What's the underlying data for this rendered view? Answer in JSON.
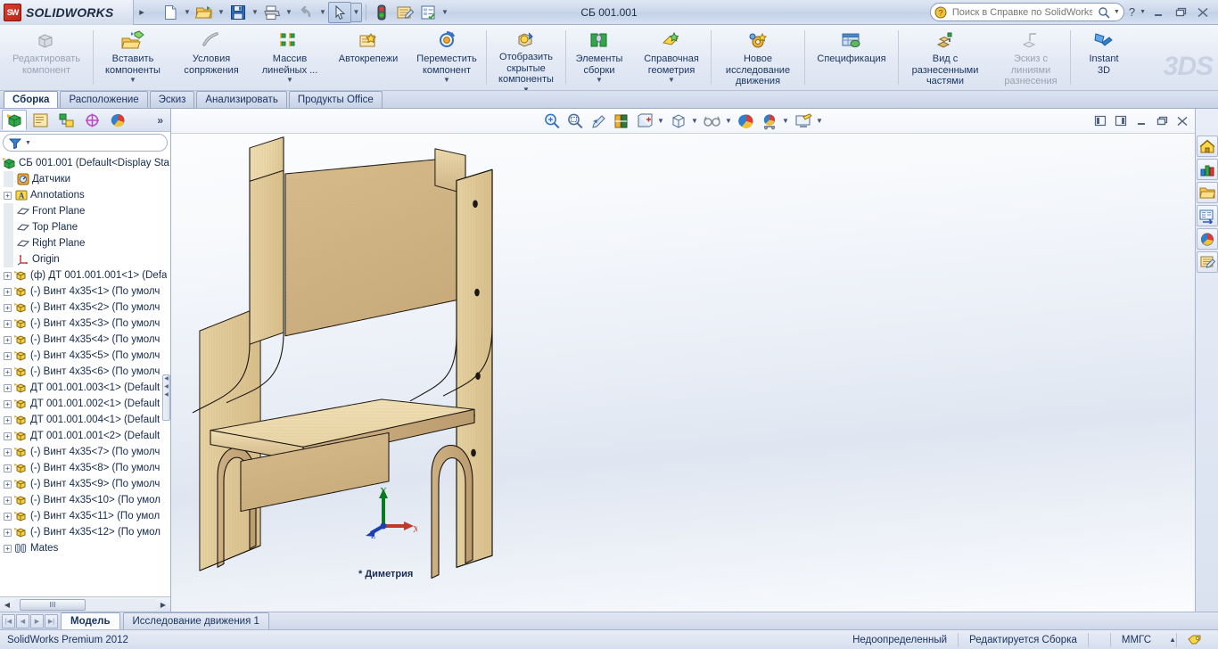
{
  "app": {
    "brand": "SOLIDWORKS",
    "brand_short": "SW",
    "document_title": "СБ 001.001",
    "watermark": "3DS",
    "status_product": "SolidWorks Premium 2012"
  },
  "titlebar": {
    "quick_access": [
      {
        "name": "new-document",
        "label": "Создать",
        "icon": "new-doc-icon",
        "dropdown": true
      },
      {
        "name": "open-document",
        "label": "Открыть",
        "icon": "open-folder-icon",
        "dropdown": true
      },
      {
        "name": "save-document",
        "label": "Сохранить",
        "icon": "save-disk-icon",
        "dropdown": true
      },
      {
        "name": "print-document",
        "label": "Печать",
        "icon": "printer-icon",
        "dropdown": true
      },
      {
        "name": "undo",
        "label": "Отменить",
        "icon": "undo-arrow-icon",
        "dropdown": true
      },
      {
        "name": "select",
        "label": "Выбрать",
        "icon": "cursor-arrow-icon",
        "dropdown": true
      },
      {
        "name": "rebuild",
        "label": "Перестроить",
        "icon": "traffic-light-icon",
        "dropdown": false
      },
      {
        "name": "options",
        "label": "Настройки",
        "icon": "options-icon",
        "dropdown": false
      },
      {
        "name": "properties",
        "label": "Свойства",
        "icon": "checklist-icon",
        "dropdown": true
      }
    ],
    "search": {
      "placeholder": "Поиск в Справке по SolidWorks",
      "value": "",
      "icon": "help-search-icon"
    },
    "help_label": "?",
    "window_buttons": [
      "minimize",
      "restore",
      "close"
    ]
  },
  "ribbon": {
    "items": [
      {
        "label": "Редактировать\nкомпонент",
        "l1": "Редактировать",
        "l2": "компонент",
        "icon": "edit-component-icon",
        "dimmed": true,
        "caret": false
      },
      {
        "label": "Вставить компоненты",
        "l1": "Вставить",
        "l2": "компоненты",
        "icon": "insert-components-icon",
        "dimmed": false,
        "caret": true
      },
      {
        "label": "Условия сопряжения",
        "l1": "Условия",
        "l2": "сопряжения",
        "icon": "mate-icon",
        "dimmed": false,
        "caret": false
      },
      {
        "label": "Массив линейных ...",
        "l1": "Массив",
        "l2": "линейных ...",
        "icon": "linear-pattern-icon",
        "dimmed": false,
        "caret": true
      },
      {
        "label": "Автокрепежи",
        "l1": "Автокрепежи",
        "l2": "",
        "icon": "smart-fasteners-icon",
        "dimmed": false,
        "caret": false
      },
      {
        "label": "Переместить компонент",
        "l1": "Переместить",
        "l2": "компонент",
        "icon": "move-component-icon",
        "dimmed": false,
        "caret": true
      },
      {
        "label": "Отобразить скрытые компоненты",
        "l1": "Отобразить",
        "l2": "скрытые",
        "l3": "компоненты",
        "icon": "show-hidden-icon",
        "dimmed": false,
        "caret": true
      },
      {
        "label": "Элементы сборки",
        "l1": "Элементы",
        "l2": "сборки",
        "icon": "assembly-features-icon",
        "dimmed": false,
        "caret": true
      },
      {
        "label": "Справочная геометрия",
        "l1": "Справочная",
        "l2": "геометрия",
        "icon": "reference-geometry-icon",
        "dimmed": false,
        "caret": true
      },
      {
        "label": "Новое исследование движения",
        "l1": "Новое",
        "l2": "исследование",
        "l3": "движения",
        "icon": "new-motion-study-icon",
        "dimmed": false,
        "caret": false
      },
      {
        "label": "Спецификация",
        "l1": "Спецификация",
        "l2": "",
        "icon": "bill-of-materials-icon",
        "dimmed": false,
        "caret": false
      },
      {
        "label": "Вид с разнесенными частями",
        "l1": "Вид с",
        "l2": "разнесенными",
        "l3": "частями",
        "icon": "exploded-view-icon",
        "dimmed": false,
        "caret": false
      },
      {
        "label": "Эскиз с линиями разнесения",
        "l1": "Эскиз с",
        "l2": "линиями",
        "l3": "разнесения",
        "icon": "explode-line-sketch-icon",
        "dimmed": true,
        "caret": false
      },
      {
        "label": "Instant 3D",
        "l1": "Instant",
        "l2": "3D",
        "icon": "instant3d-icon",
        "dimmed": false,
        "caret": false
      }
    ]
  },
  "command_tabs": {
    "tabs": [
      {
        "label": "Сборка",
        "active": true
      },
      {
        "label": "Расположение",
        "active": false
      },
      {
        "label": "Эскиз",
        "active": false
      },
      {
        "label": "Анализировать",
        "active": false
      },
      {
        "label": "Продукты Office",
        "active": false
      }
    ]
  },
  "feature_manager": {
    "tabs": [
      {
        "name": "feature-tree-tab",
        "icon": "feature-tree-icon",
        "active": true
      },
      {
        "name": "property-manager-tab",
        "icon": "property-manager-icon",
        "active": false
      },
      {
        "name": "configuration-manager-tab",
        "icon": "configuration-manager-icon",
        "active": false
      },
      {
        "name": "dimxpert-manager-tab",
        "icon": "dimxpert-icon",
        "active": false
      },
      {
        "name": "display-manager-tab",
        "icon": "display-manager-icon",
        "active": false
      }
    ],
    "more_label": "»",
    "filter": {
      "placeholder": "",
      "value": "",
      "icon": "filter-funnel-icon"
    },
    "tree": [
      {
        "label": "СБ 001.001  (Default<Display Sta",
        "icon": "assembly-icon",
        "expand": "none",
        "indent": 0,
        "root": true
      },
      {
        "label": "Датчики",
        "icon": "sensors-icon",
        "expand": "none",
        "indent": 1
      },
      {
        "label": "Annotations",
        "icon": "annotations-icon",
        "expand": "plus",
        "indent": 1
      },
      {
        "label": "Front Plane",
        "icon": "plane-icon",
        "expand": "none",
        "indent": 1
      },
      {
        "label": "Top Plane",
        "icon": "plane-icon",
        "expand": "none",
        "indent": 1
      },
      {
        "label": "Right Plane",
        "icon": "plane-icon",
        "expand": "none",
        "indent": 1
      },
      {
        "label": "Origin",
        "icon": "origin-icon",
        "expand": "none",
        "indent": 1
      },
      {
        "label": "(ф) ДТ 001.001.001<1>  (Defa",
        "icon": "part-icon",
        "expand": "plus",
        "indent": 1
      },
      {
        "label": "(-) Винт 4x35<1>  (По умолч",
        "icon": "part-icon",
        "expand": "plus",
        "indent": 1
      },
      {
        "label": "(-) Винт 4x35<2>  (По умолч",
        "icon": "part-icon",
        "expand": "plus",
        "indent": 1
      },
      {
        "label": "(-) Винт 4x35<3>  (По умолч",
        "icon": "part-icon",
        "expand": "plus",
        "indent": 1
      },
      {
        "label": "(-) Винт 4x35<4>  (По умолч",
        "icon": "part-icon",
        "expand": "plus",
        "indent": 1
      },
      {
        "label": "(-) Винт 4x35<5>  (По умолч",
        "icon": "part-icon",
        "expand": "plus",
        "indent": 1
      },
      {
        "label": "(-) Винт 4x35<6>  (По умолч",
        "icon": "part-icon",
        "expand": "plus",
        "indent": 1
      },
      {
        "label": "ДТ 001.001.003<1>  (Default",
        "icon": "part-icon",
        "expand": "plus",
        "indent": 1
      },
      {
        "label": "ДТ 001.001.002<1>  (Default",
        "icon": "part-icon",
        "expand": "plus",
        "indent": 1
      },
      {
        "label": "ДТ 001.001.004<1>  (Default",
        "icon": "part-icon",
        "expand": "plus",
        "indent": 1
      },
      {
        "label": "ДТ 001.001.001<2>  (Default",
        "icon": "part-icon",
        "expand": "plus",
        "indent": 1
      },
      {
        "label": "(-) Винт 4x35<7>  (По умолч",
        "icon": "part-icon",
        "expand": "plus",
        "indent": 1
      },
      {
        "label": "(-) Винт 4x35<8>  (По умолч",
        "icon": "part-icon",
        "expand": "plus",
        "indent": 1
      },
      {
        "label": "(-) Винт 4x35<9>  (По умолч",
        "icon": "part-icon",
        "expand": "plus",
        "indent": 1
      },
      {
        "label": "(-) Винт 4x35<10>  (По умол",
        "icon": "part-icon",
        "expand": "plus",
        "indent": 1
      },
      {
        "label": "(-) Винт 4x35<11>  (По умол",
        "icon": "part-icon",
        "expand": "plus",
        "indent": 1
      },
      {
        "label": "(-) Винт 4x35<12>  (По умол",
        "icon": "part-icon",
        "expand": "plus",
        "indent": 1
      },
      {
        "label": "Mates",
        "icon": "mates-icon",
        "expand": "plus",
        "indent": 1
      }
    ],
    "hscroll_thumb_label": "III"
  },
  "view_toolbar": {
    "buttons": [
      {
        "name": "zoom-to-fit-button",
        "icon": "zoom-fit-icon",
        "caret": false
      },
      {
        "name": "zoom-to-area-button",
        "icon": "zoom-area-icon",
        "caret": false
      },
      {
        "name": "previous-view-button",
        "icon": "previous-view-icon",
        "caret": false
      },
      {
        "name": "section-view-button",
        "icon": "section-view-icon",
        "caret": false
      },
      {
        "name": "view-orientation-button",
        "icon": "view-orientation-icon",
        "caret": true
      },
      {
        "name": "display-style-button",
        "icon": "display-style-icon",
        "caret": true
      },
      {
        "name": "hide-show-items-button",
        "icon": "glasses-icon",
        "caret": true
      },
      {
        "name": "edit-appearance-button",
        "icon": "appearance-sphere-icon",
        "caret": false
      },
      {
        "name": "apply-scene-button",
        "icon": "scene-icon",
        "caret": true
      },
      {
        "name": "view-settings-button",
        "icon": "view-settings-icon",
        "caret": true
      }
    ],
    "window_controls": [
      {
        "name": "restore-left-pane-button",
        "icon": "pane-left-icon"
      },
      {
        "name": "restore-right-pane-button",
        "icon": "pane-right-icon"
      },
      {
        "name": "minimize-doc-button",
        "icon": "minimize-icon"
      },
      {
        "name": "restore-doc-button",
        "icon": "restore-icon"
      },
      {
        "name": "close-doc-button",
        "icon": "close-icon"
      }
    ]
  },
  "viewport": {
    "view_label": "* Диметрия",
    "triad": {
      "x": "X",
      "y": "Y",
      "z": "Z"
    },
    "model": {
      "name": "wooden-chair-assembly",
      "wood_light": "#f0dcaa",
      "wood_mid": "#dcc089",
      "wood_dark": "#c4a36b",
      "wood_shadow": "#b08f5e",
      "seat_top": "#f5e4b8",
      "back_panel": "#d3b787",
      "outline": "#14110c"
    }
  },
  "task_pane": {
    "buttons": [
      {
        "name": "solidworks-resources-button",
        "icon": "home-house-icon"
      },
      {
        "name": "design-library-button",
        "icon": "bar-chart-books-icon"
      },
      {
        "name": "file-explorer-button",
        "icon": "folder-icon"
      },
      {
        "name": "search-pane-button",
        "icon": "search-pane-icon"
      },
      {
        "name": "appearances-scenes-button",
        "icon": "appearance-sphere-icon"
      },
      {
        "name": "custom-properties-button",
        "icon": "custom-properties-icon"
      }
    ]
  },
  "bottom_tabs": {
    "nav": [
      "first",
      "previous",
      "next",
      "last"
    ],
    "tabs": [
      {
        "label": "Модель",
        "active": true
      },
      {
        "label": "Исследование движения 1",
        "active": false
      }
    ]
  },
  "status_bar": {
    "product": "SolidWorks Premium 2012",
    "state": "Недоопределенный",
    "edit_mode": "Редактируется Сборка",
    "units": "ММГС",
    "units_caret": "▲",
    "tag_icon": "tag-icon"
  }
}
